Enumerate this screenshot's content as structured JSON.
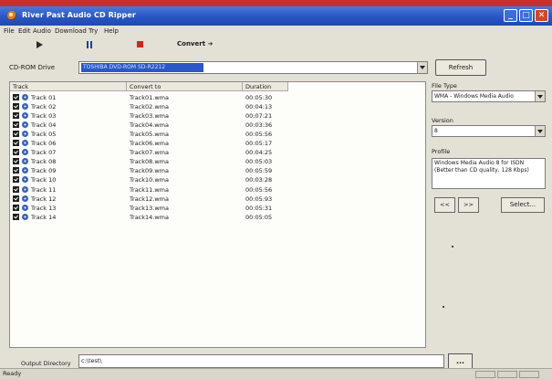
{
  "window": {
    "title": "River Past Audio CD Ripper"
  },
  "menu": [
    "File",
    "Edit",
    "Audio",
    "Download",
    "Try",
    "Help"
  ],
  "toolbar": {
    "convert_label": "Convert ➔"
  },
  "cdrom": {
    "label": "CD-ROM Drive",
    "value": "TOSHIBA DVD-ROM SD-R2212",
    "refresh_label": "Refresh"
  },
  "tracklist": {
    "columns": [
      "Track",
      "Convert to",
      "Duration"
    ],
    "rows": [
      {
        "track": "Track 01",
        "convert": "Track01.wma",
        "duration": "00:05:30"
      },
      {
        "track": "Track 02",
        "convert": "Track02.wma",
        "duration": "00:04:13"
      },
      {
        "track": "Track 03",
        "convert": "Track03.wma",
        "duration": "00:07:21"
      },
      {
        "track": "Track 04",
        "convert": "Track04.wma",
        "duration": "00:03:36"
      },
      {
        "track": "Track 05",
        "convert": "Track05.wma",
        "duration": "00:05:56"
      },
      {
        "track": "Track 06",
        "convert": "Track06.wma",
        "duration": "00:05:17"
      },
      {
        "track": "Track 07",
        "convert": "Track07.wma",
        "duration": "00:04:25"
      },
      {
        "track": "Track 08",
        "convert": "Track08.wma",
        "duration": "00:05:03"
      },
      {
        "track": "Track 09",
        "convert": "Track09.wma",
        "duration": "00:05:59"
      },
      {
        "track": "Track 10",
        "convert": "Track10.wma",
        "duration": "00:03:28"
      },
      {
        "track": "Track 11",
        "convert": "Track11.wma",
        "duration": "00:05:56"
      },
      {
        "track": "Track 12",
        "convert": "Track12.wma",
        "duration": "00:05:93"
      },
      {
        "track": "Track 13",
        "convert": "Track13.wma",
        "duration": "00:05:31"
      },
      {
        "track": "Track 14",
        "convert": "Track14.wma",
        "duration": "00:05:05"
      }
    ]
  },
  "right_panel": {
    "file_type_label": "File Type",
    "file_type_value": "WMA - Windows Media Audio",
    "version_label": "Version",
    "version_value": "8",
    "profile_label": "Profile",
    "profile_text": "Windows Media Audio 8 for ISDN (Better than CD quality, 128 Kbps)",
    "prev_label": "<<",
    "next_label": ">>",
    "select_label": "Select..."
  },
  "output": {
    "label": "Output Directory",
    "value": "c:\\test\\",
    "browse_label": "..."
  },
  "status": {
    "text": "Ready"
  },
  "colors": {
    "titlebar": "#2a56c4",
    "close_button": "#d0462a",
    "selection": "#2c58c7"
  }
}
